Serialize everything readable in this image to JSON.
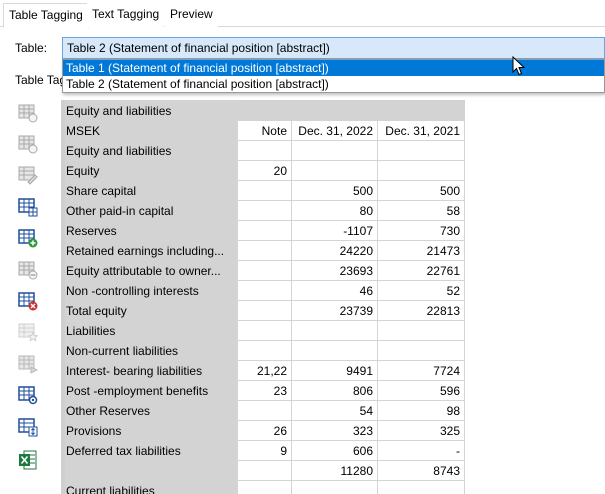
{
  "tabs": [
    {
      "label": "Table Tagging",
      "active": true
    },
    {
      "label": "Text Tagging",
      "active": false
    },
    {
      "label": "Preview",
      "active": false
    }
  ],
  "table_label": "Table:",
  "table_tag_label": "Table Tag",
  "combo": {
    "selected": "Table 2 (Statement of financial position [abstract])",
    "options": [
      "Table 1 (Statement of financial position [abstract])",
      "Table 2 (Statement of financial position [abstract])"
    ],
    "highlighted_index": 0
  },
  "toolbar": [
    {
      "name": "table-insert-icon"
    },
    {
      "name": "table-settings-icon"
    },
    {
      "name": "table-edit-icon"
    },
    {
      "name": "table-grid-icon"
    },
    {
      "name": "table-add-icon"
    },
    {
      "name": "table-remove-icon"
    },
    {
      "name": "table-delete-icon"
    },
    {
      "name": "table-star-disabled-icon"
    },
    {
      "name": "table-export-disabled-icon"
    },
    {
      "name": "table-gear-icon"
    },
    {
      "name": "table-sort-icon"
    },
    {
      "name": "excel-icon"
    }
  ],
  "grid": {
    "rows": [
      [
        "Equity and liabilities",
        "",
        "",
        ""
      ],
      [
        "MSEK",
        "Note",
        "Dec. 31, 2022",
        "Dec. 31, 2021"
      ],
      [
        "Equity and liabilities",
        "",
        "",
        ""
      ],
      [
        "Equity",
        "20",
        "",
        ""
      ],
      [
        "Share capital",
        "",
        "500",
        "500"
      ],
      [
        "Other paid-in capital",
        "",
        "80",
        "58"
      ],
      [
        "Reserves",
        "",
        "-1107",
        "730"
      ],
      [
        "Retained earnings including...",
        "",
        "24220",
        "21473"
      ],
      [
        "Equity attributable to owner...",
        "",
        "23693",
        "22761"
      ],
      [
        "Non -controlling interests",
        "",
        "46",
        "52"
      ],
      [
        "Total equity",
        "",
        "23739",
        "22813"
      ],
      [
        "Liabilities",
        "",
        "",
        ""
      ],
      [
        "Non-current liabilities",
        "",
        "",
        ""
      ],
      [
        "Interest- bearing liabilities",
        "21,22",
        "9491",
        "7724"
      ],
      [
        "Post -employment benefits",
        "23",
        "806",
        "596"
      ],
      [
        "Other Reserves",
        "",
        "54",
        "98"
      ],
      [
        "Provisions",
        "26",
        "323",
        "325"
      ],
      [
        "Deferred tax liabilities",
        "9",
        "606",
        "-"
      ],
      [
        "",
        "",
        "11280",
        "8743"
      ],
      [
        "Current liabilities",
        "",
        "",
        ""
      ]
    ]
  },
  "colors": {
    "accent": "#0078d7",
    "combo_bg": "#d6e8f9",
    "label_column": "#d3d3d3",
    "excel_green": "#1d7a3f",
    "icon_blue": "#1f4f9c",
    "icon_red": "#d0312d",
    "icon_gray": "#a8a8a8"
  }
}
